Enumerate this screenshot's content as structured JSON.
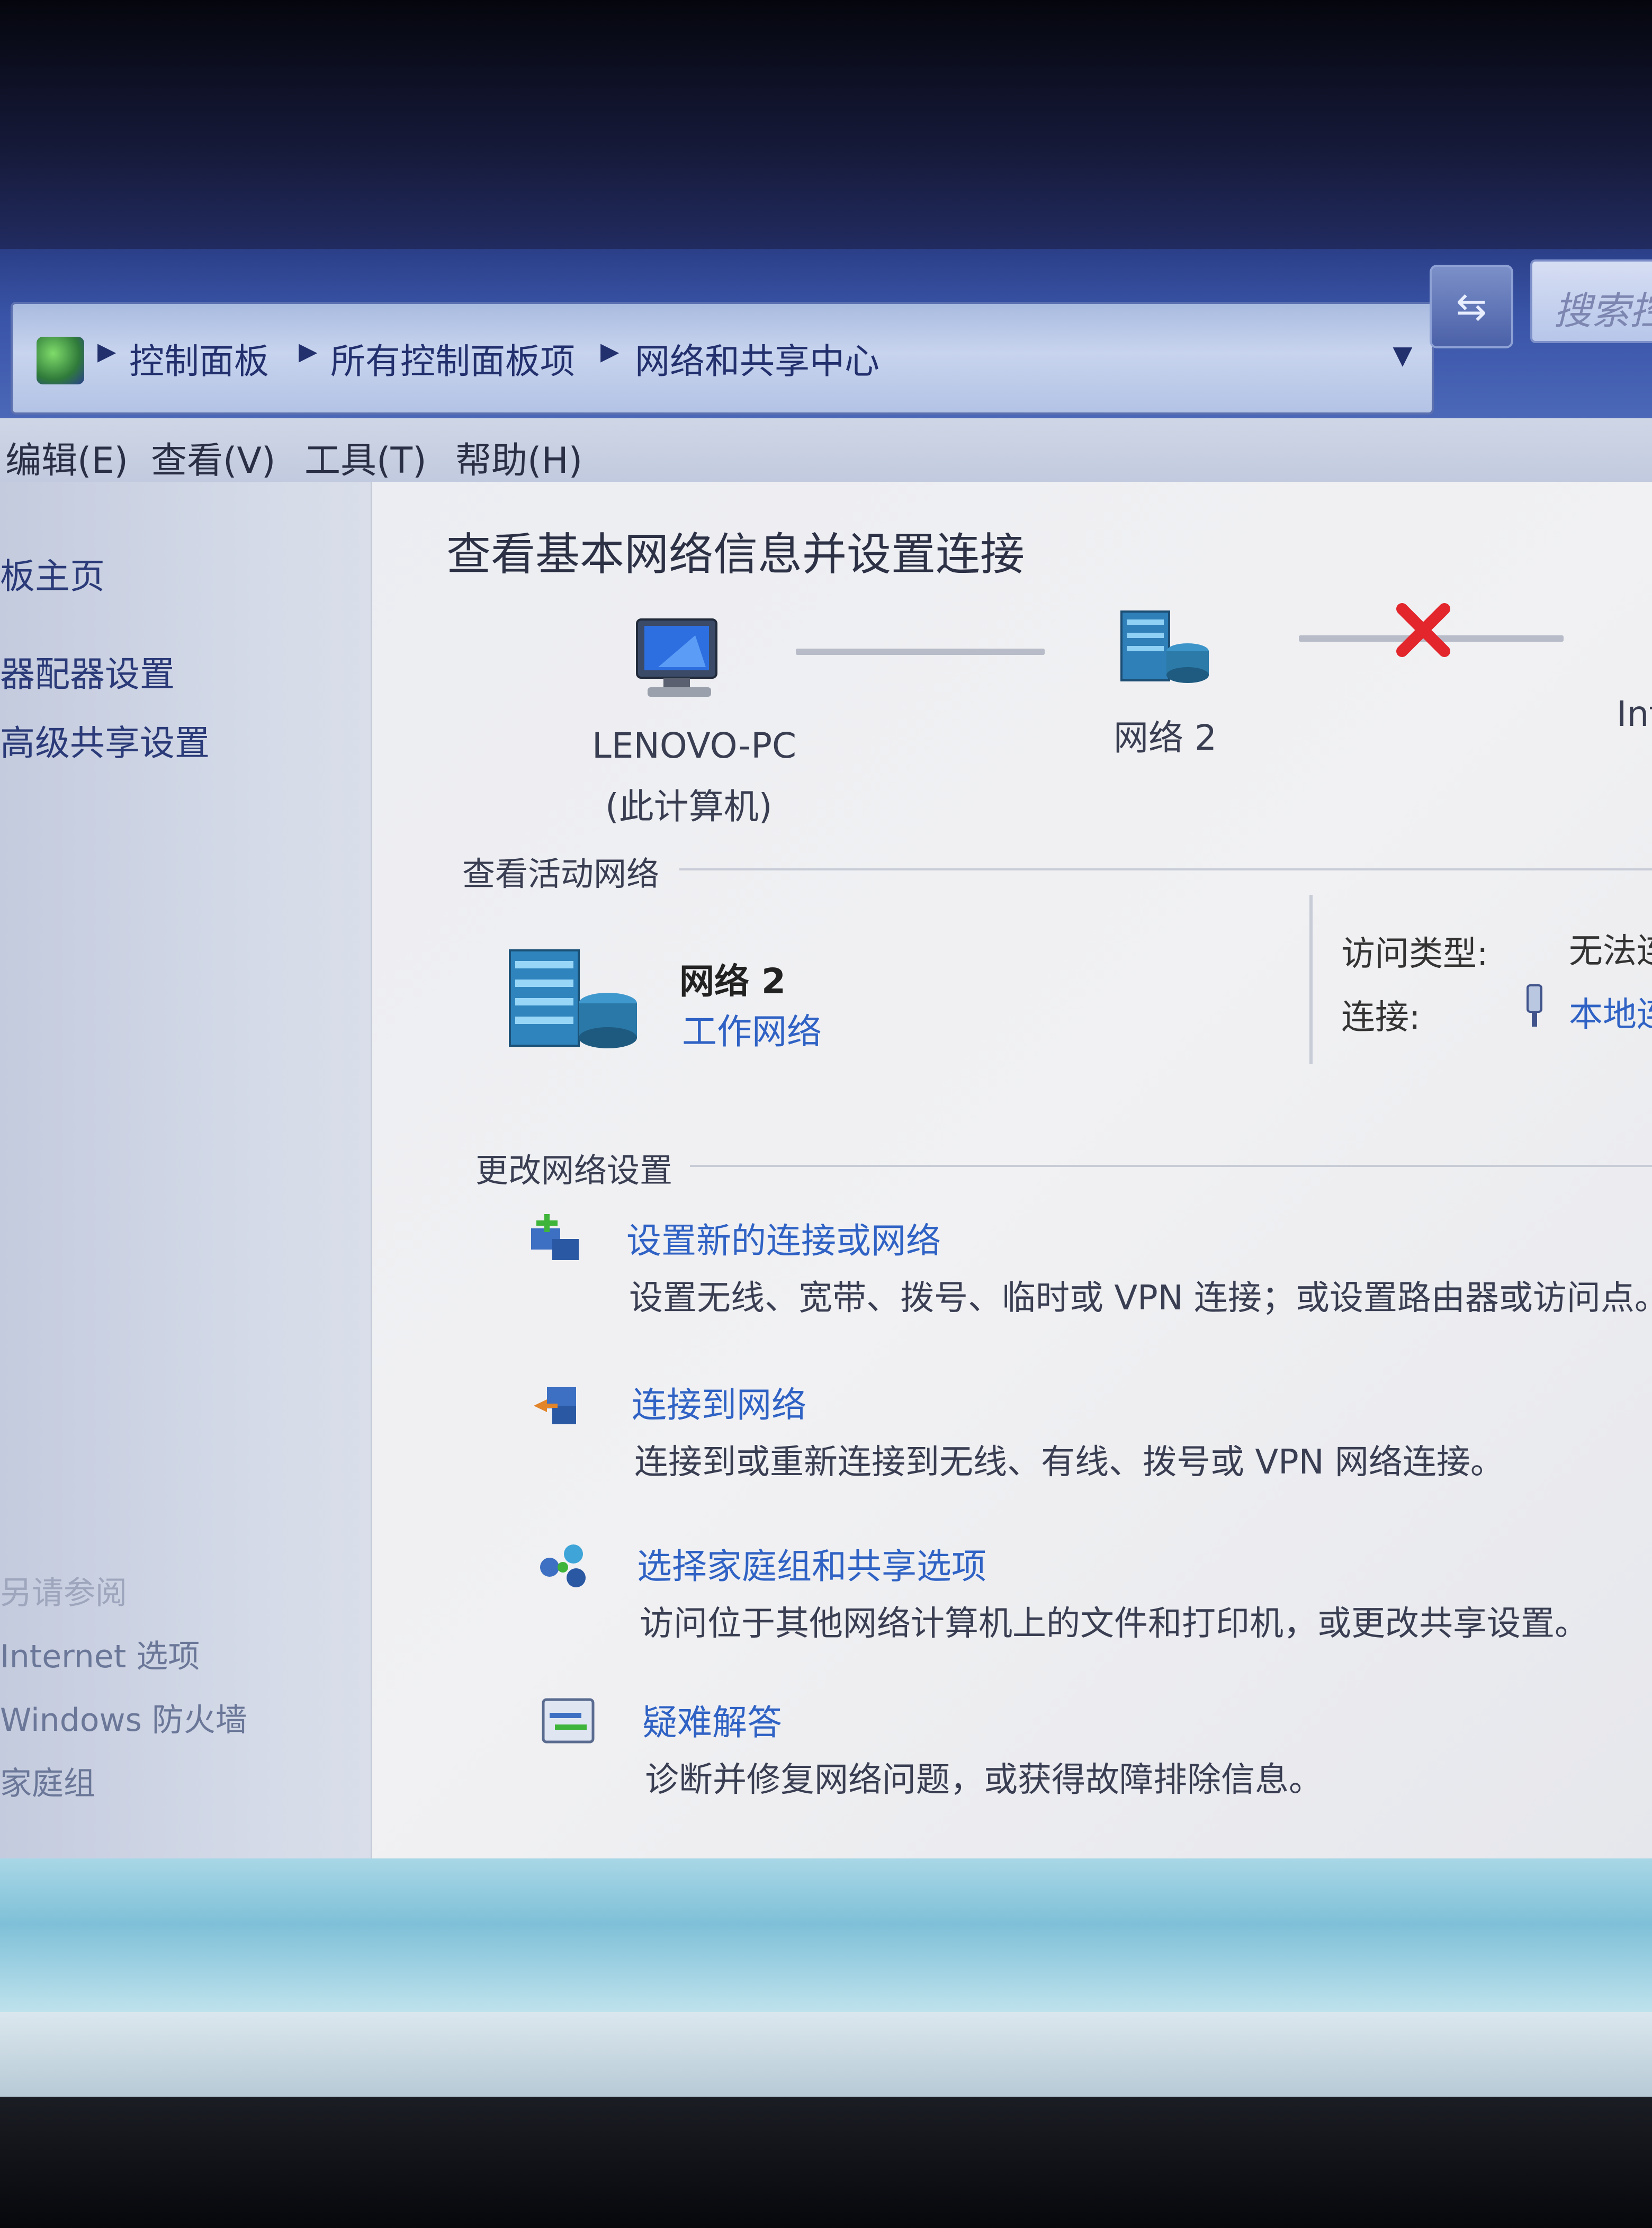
{
  "address_bar": {
    "crumbs": [
      "控制面板",
      "所有控制面板项",
      "网络和共享中心"
    ],
    "search_placeholder": "搜索控"
  },
  "menu": [
    "编辑(E)",
    "查看(V)",
    "工具(T)",
    "帮助(H)"
  ],
  "sidebar": {
    "links": [
      "板主页",
      "器配器设置",
      "高级共享设置"
    ],
    "see_also_heading": "另请参阅",
    "see_also": [
      "Internet 选项",
      "Windows 防火墙",
      "家庭组"
    ]
  },
  "main": {
    "title": "查看基本网络信息并设置连接",
    "map": {
      "computer_name": "LENOVO-PC",
      "computer_sub": "(此计算机)",
      "network_name": "网络  2",
      "internet_label": "Int"
    },
    "active_networks": {
      "header": "查看活动网络",
      "network_name": "网络  2",
      "network_type": "工作网络",
      "access_type_label": "访问类型:",
      "access_type_value": "无法连",
      "connection_label": "连接:",
      "connection_value": "本地连"
    },
    "change_settings": {
      "header": "更改网络设置",
      "tasks": [
        {
          "title": "设置新的连接或网络",
          "desc": "设置无线、宽带、拨号、临时或 VPN 连接；或设置路由器或访问点。"
        },
        {
          "title": "连接到网络",
          "desc": "连接到或重新连接到无线、有线、拨号或 VPN 网络连接。"
        },
        {
          "title": "选择家庭组和共享选项",
          "desc": "访问位于其他网络计算机上的文件和打印机，或更改共享设置。"
        },
        {
          "title": "疑难解答",
          "desc": "诊断并修复网络问题，或获得故障排除信息。"
        }
      ]
    }
  },
  "colors": {
    "link": "#2f62c4",
    "address_bar": "#3a55a8",
    "error_x": "#e2262b"
  }
}
